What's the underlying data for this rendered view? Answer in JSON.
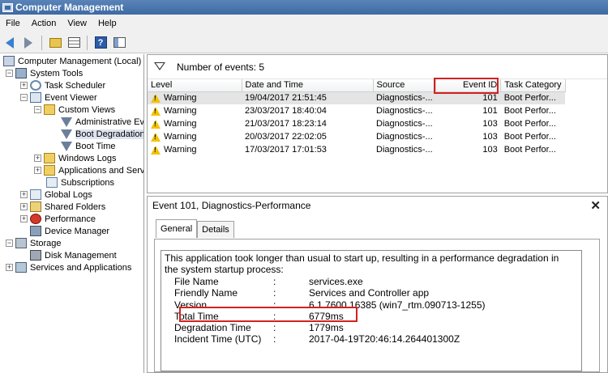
{
  "window": {
    "title": "Computer Management"
  },
  "menu": [
    "File",
    "Action",
    "View",
    "Help"
  ],
  "toolbar": {
    "icons": [
      "back-arrow-icon",
      "forward-arrow-icon",
      "up-folder-icon",
      "show-hide-console-tree-icon",
      "help-icon",
      "action-pane-icon"
    ],
    "help_glyph": "?"
  },
  "tree": {
    "root": "Computer Management (Local)",
    "system_tools": "System Tools",
    "task_scheduler": "Task Scheduler",
    "event_viewer": "Event Viewer",
    "custom_views": "Custom Views",
    "administrative_events": "Administrative Eve",
    "boot_degradation": "Boot Degradation",
    "boot_time": "Boot Time",
    "windows_logs": "Windows Logs",
    "app_services_logs": "Applications and Servi",
    "subscriptions": "Subscriptions",
    "global_logs": "Global Logs",
    "shared_folders": "Shared Folders",
    "performance": "Performance",
    "device_manager": "Device Manager",
    "storage": "Storage",
    "disk_management": "Disk Management",
    "services_and_apps": "Services and Applications",
    "expand_plus": "+",
    "expand_minus": "−"
  },
  "events": {
    "count_label": "Number of events: 5",
    "columns": [
      "Level",
      "Date and Time",
      "Source",
      "Event ID",
      "Task Category"
    ],
    "rows": [
      {
        "level": "Warning",
        "datetime": "19/04/2017 21:51:45",
        "source": "Diagnostics-...",
        "event_id": "101",
        "category": "Boot Perfor..."
      },
      {
        "level": "Warning",
        "datetime": "23/03/2017 18:40:04",
        "source": "Diagnostics-...",
        "event_id": "101",
        "category": "Boot Perfor..."
      },
      {
        "level": "Warning",
        "datetime": "21/03/2017 18:23:14",
        "source": "Diagnostics-...",
        "event_id": "103",
        "category": "Boot Perfor..."
      },
      {
        "level": "Warning",
        "datetime": "20/03/2017 22:02:05",
        "source": "Diagnostics-...",
        "event_id": "103",
        "category": "Boot Perfor..."
      },
      {
        "level": "Warning",
        "datetime": "17/03/2017 17:01:53",
        "source": "Diagnostics-...",
        "event_id": "103",
        "category": "Boot Perfor..."
      }
    ]
  },
  "detail": {
    "header": "Event 101, Diagnostics-Performance",
    "close_glyph": "✕",
    "tabs": [
      "General",
      "Details"
    ],
    "description": "This application took longer than usual to start up, resulting in a performance degradation in the system startup process:",
    "fields": [
      {
        "key": "File Name",
        "sep": ":",
        "value": "services.exe"
      },
      {
        "key": "Friendly Name",
        "sep": ":",
        "value": "Services and Controller app"
      },
      {
        "key": "Version",
        "sep": ":",
        "value": "6.1.7600.16385 (win7_rtm.090713-1255)"
      },
      {
        "key": "Total Time",
        "sep": ":",
        "value": "6779ms"
      },
      {
        "key": "Degradation Time",
        "sep": ":",
        "value": "1779ms"
      },
      {
        "key": "Incident Time (UTC)",
        "sep": ":",
        "value": "2017-04-19T20:46:14.264401300Z"
      }
    ]
  },
  "colors": {
    "highlight": "#d42020",
    "titlebar": "#3e6aa3",
    "warning": "#f2c200"
  }
}
